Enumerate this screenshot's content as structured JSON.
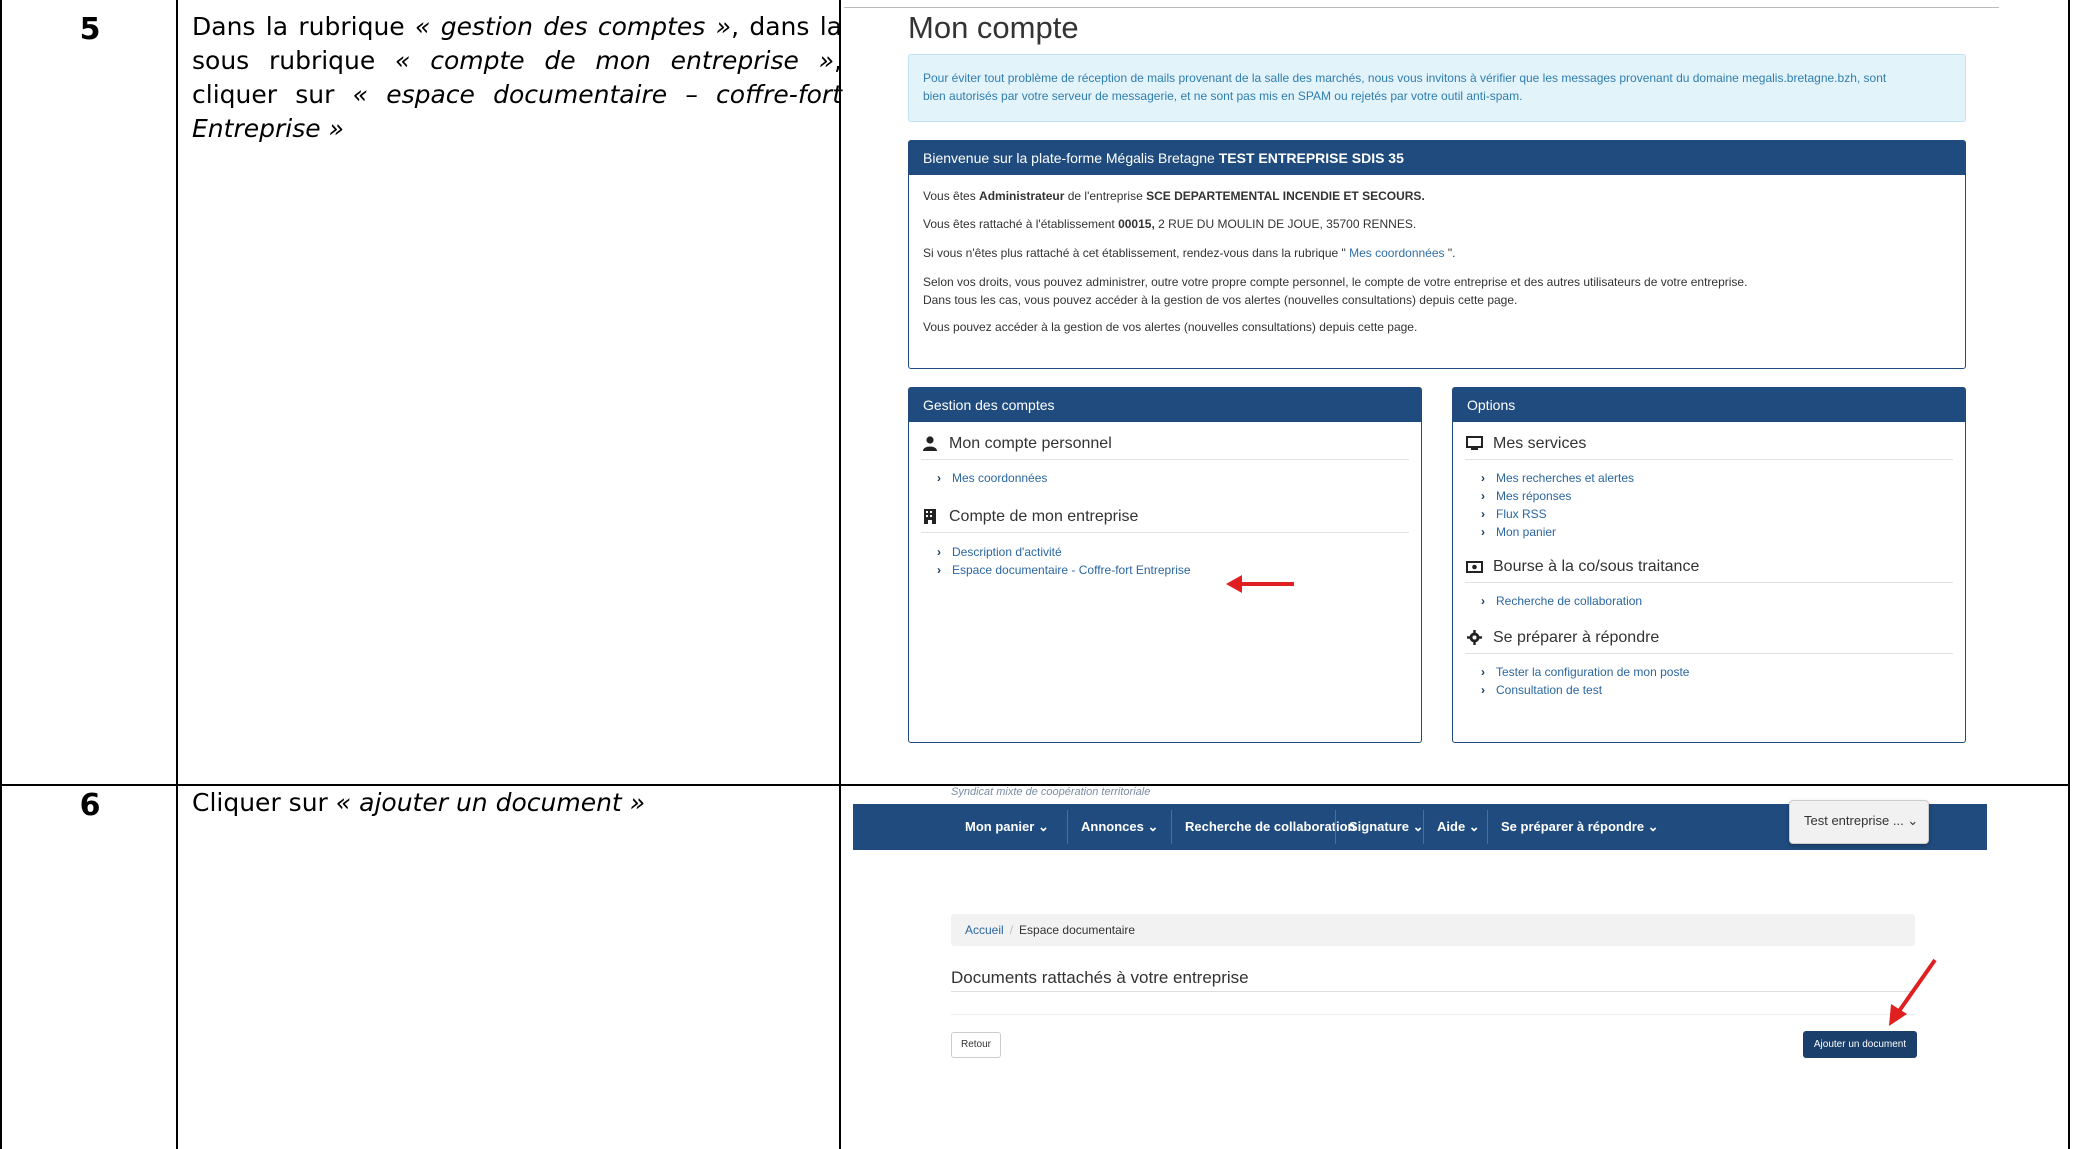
{
  "rows": [
    {
      "number": "5",
      "instruction": {
        "parts": [
          {
            "text": "Dans la rubrique ",
            "italic": false
          },
          {
            "text": "« gestion des comptes »",
            "italic": true
          },
          {
            "text": ", dans la sous rubrique ",
            "italic": false
          },
          {
            "text": "« compte de mon entreprise »",
            "italic": true
          },
          {
            "text": ", cliquer sur ",
            "italic": false
          },
          {
            "text": "« espace documentaire – coffre-fort Entreprise »",
            "italic": true
          }
        ]
      }
    },
    {
      "number": "6",
      "instruction": {
        "parts": [
          {
            "text": "Cliquer sur ",
            "italic": false
          },
          {
            "text": "« ajouter un document »",
            "italic": true
          }
        ]
      }
    }
  ],
  "shot1": {
    "title": "Mon compte",
    "alert_line1": "Pour éviter tout problème de réception de mails provenant de la salle des marchés, nous vous invitons à vérifier que les messages provenant du domaine megalis.bretagne.bzh, sont",
    "alert_line2": "bien autorisés par votre serveur de messagerie, et ne sont pas mis en SPAM ou rejetés par votre outil anti-spam.",
    "welcome": {
      "head_prefix": "Bienvenue sur la plate-forme Mégalis Bretagne ",
      "head_bold": "TEST ENTREPRISE SDIS 35",
      "l1_a": "Vous êtes ",
      "l1_b": "Administrateur",
      "l1_c": " de l'entreprise ",
      "l1_d": "SCE DEPARTEMENTAL INCENDIE ET SECOURS.",
      "l2_a": "Vous êtes rattaché à l'établissement ",
      "l2_b": "00015,",
      "l2_c": "  2 RUE DU MOULIN DE JOUE, 35700 RENNES.",
      "l3_a": "Si vous n'êtes plus rattaché à cet établissement, rendez-vous dans la rubrique \" ",
      "l3_link": "Mes coordonnées",
      "l3_c": " \".",
      "l4": "Selon vos droits, vous pouvez administrer, outre votre propre compte personnel, le compte de votre entreprise et des autres utilisateurs de votre entreprise.",
      "l5": "Dans tous les cas, vous pouvez accéder à la gestion de vos alertes (nouvelles consultations) depuis cette page.",
      "l6": "Vous pouvez accéder à la gestion de vos alertes (nouvelles consultations) depuis cette page."
    },
    "gestion": {
      "head": "Gestion des comptes",
      "perso_title": "Mon compte personnel",
      "perso_link": "Mes coordonnées",
      "ent_title": "Compte de mon entreprise",
      "ent_link1": "Description d'activité",
      "ent_link2": "Espace documentaire - Coffre-fort Entreprise"
    },
    "options": {
      "head": "Options",
      "services_title": "Mes services",
      "services_links": [
        "Mes recherches et alertes",
        "Mes réponses",
        "Flux RSS",
        "Mon panier"
      ],
      "bourse_title": "Bourse à la co/sous traitance",
      "bourse_link": "Recherche de collaboration",
      "prep_title": "Se préparer à répondre",
      "prep_link1": "Tester la configuration de mon poste",
      "prep_link2": "Consultation de test"
    }
  },
  "shot2": {
    "syndicat": "Syndicat mixte de coopération territoriale",
    "nav": [
      "Mon panier ⌄",
      "Annonces ⌄",
      "Recherche de collaboration",
      "Signature ⌄",
      "Aide ⌄",
      "Se préparer à répondre ⌄"
    ],
    "user_tab": "Test entreprise ...  ⌄",
    "breadcrumb_home": "Accueil",
    "breadcrumb_current": "Espace documentaire",
    "docs_title": "Documents rattachés à votre entreprise",
    "retour": "Retour",
    "add_doc": "Ajouter un document"
  },
  "colors": {
    "brand_navy": "#1f4b7e",
    "link_blue": "#2a66a0",
    "info_bg": "#e3f3fa",
    "arrow_red": "#e02020"
  }
}
